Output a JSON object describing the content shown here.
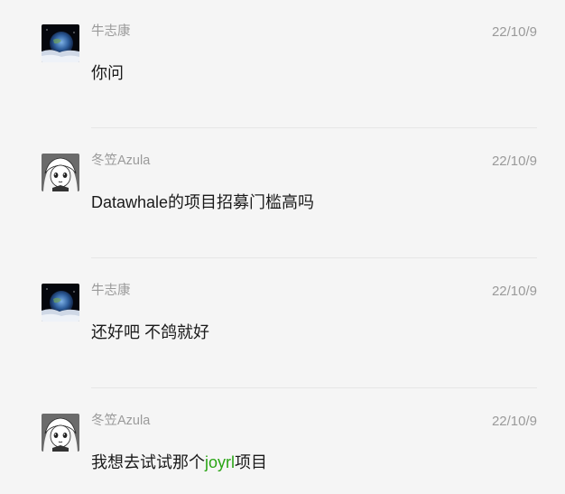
{
  "messages": [
    {
      "sender": "牛志康",
      "time": "22/10/9",
      "text": "你问",
      "avatar": "moon-earth-avatar"
    },
    {
      "sender": "冬笠Azula",
      "time": "22/10/9",
      "text": "Datawhale的项目招募门槛高吗",
      "avatar": "manga-girl-avatar"
    },
    {
      "sender": "牛志康",
      "time": "22/10/9",
      "text": "还好吧 不鸽就好",
      "avatar": "moon-earth-avatar"
    },
    {
      "sender": "冬笠Azula",
      "time": "22/10/9",
      "text_before": "我想去试试那个",
      "text_link": "joyrl",
      "text_after": "项目",
      "avatar": "manga-girl-avatar"
    }
  ],
  "colors": {
    "background": "#f5f5f5",
    "meta_text": "#9a9a9a",
    "message_text": "#1a1a1a",
    "link": "#2aa515",
    "divider": "#e6e6e6"
  }
}
